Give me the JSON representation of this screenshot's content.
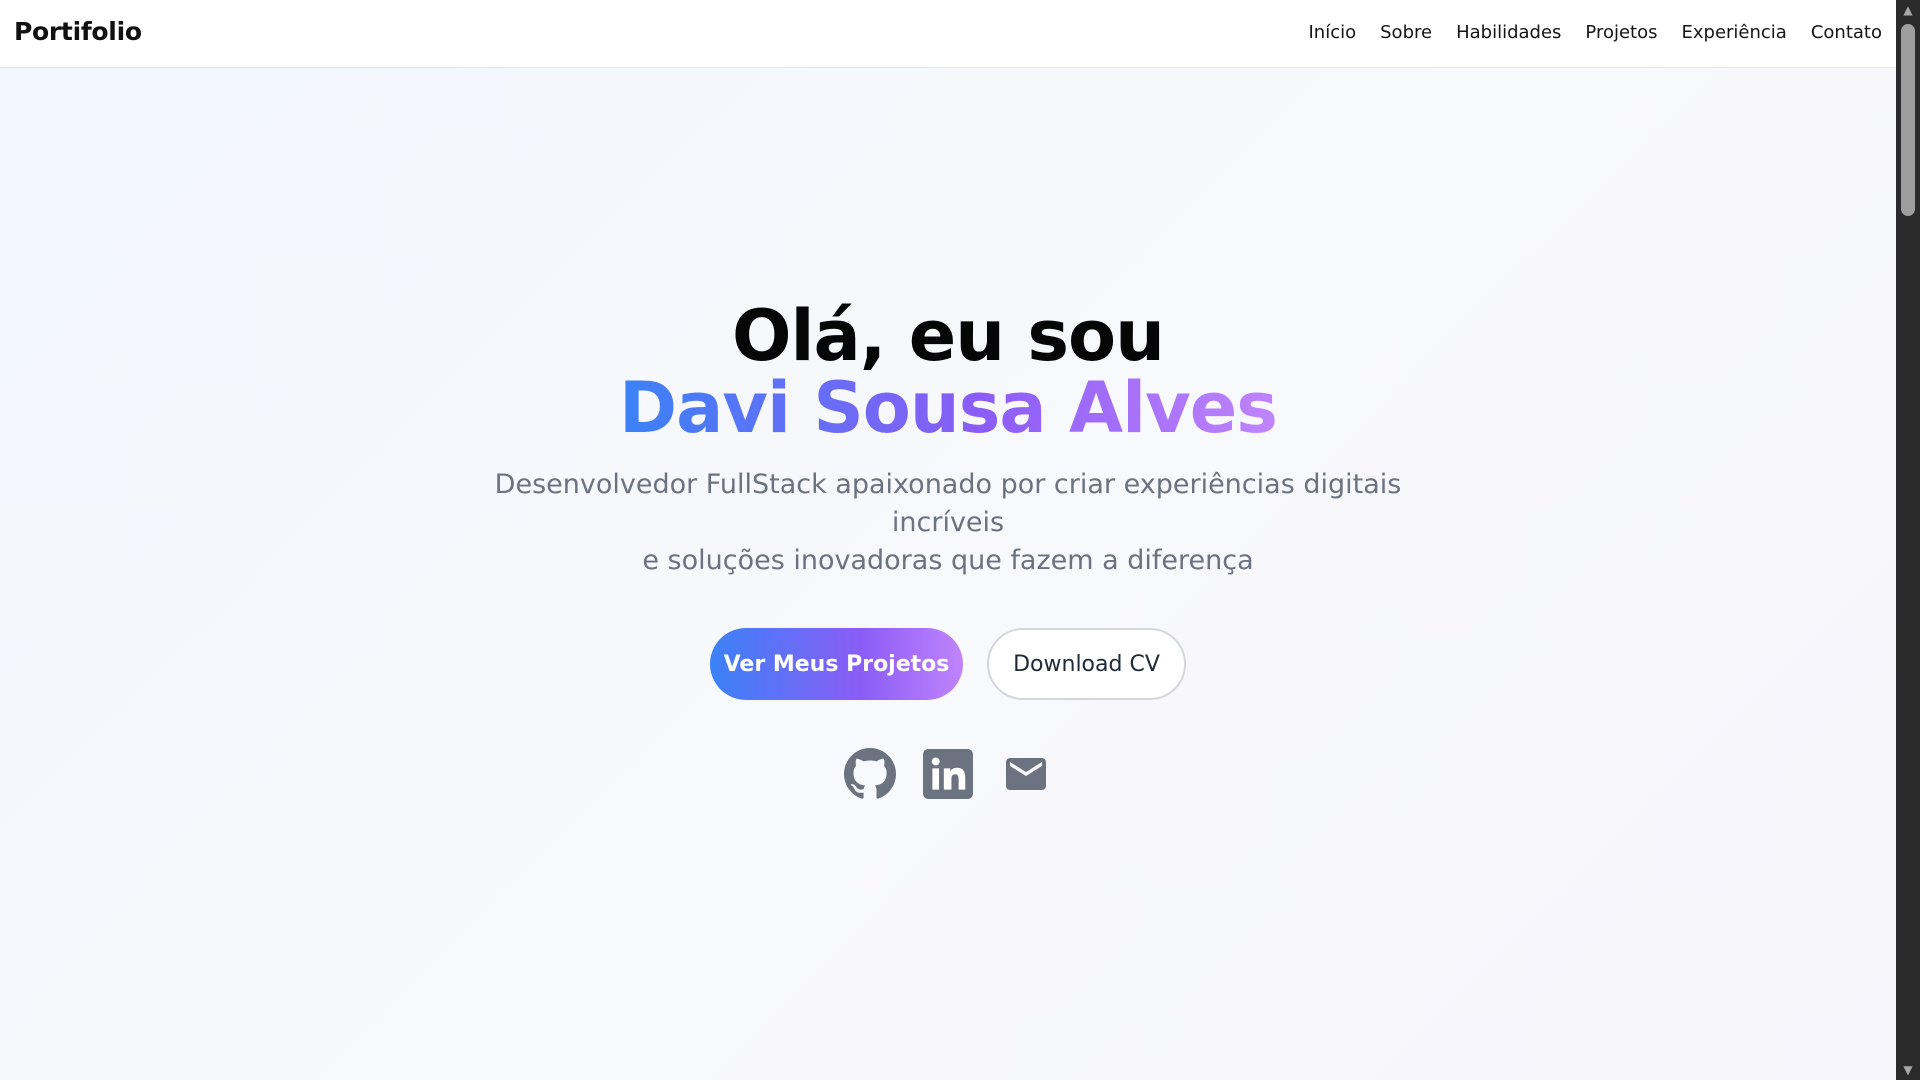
{
  "header": {
    "brand": "Portifolio",
    "nav": [
      "Início",
      "Sobre",
      "Habilidades",
      "Projetos",
      "Experiência",
      "Contato"
    ]
  },
  "hero": {
    "greeting": "Olá, eu sou",
    "name": "Davi Sousa Alves",
    "subtitle_line1": "Desenvolvedor FullStack apaixonado por criar experiências digitais incríveis",
    "subtitle_line2": "e soluções inovadoras que fazem a diferença",
    "primary_button": "Ver Meus Projetos",
    "secondary_button": "Download CV",
    "socials": [
      "github-icon",
      "linkedin-icon",
      "mail-icon"
    ]
  },
  "colors": {
    "accent_start": "#3b82f6",
    "accent_mid": "#8b5cf6",
    "accent_end": "#c084fc",
    "icon_gray": "#6b7280"
  }
}
